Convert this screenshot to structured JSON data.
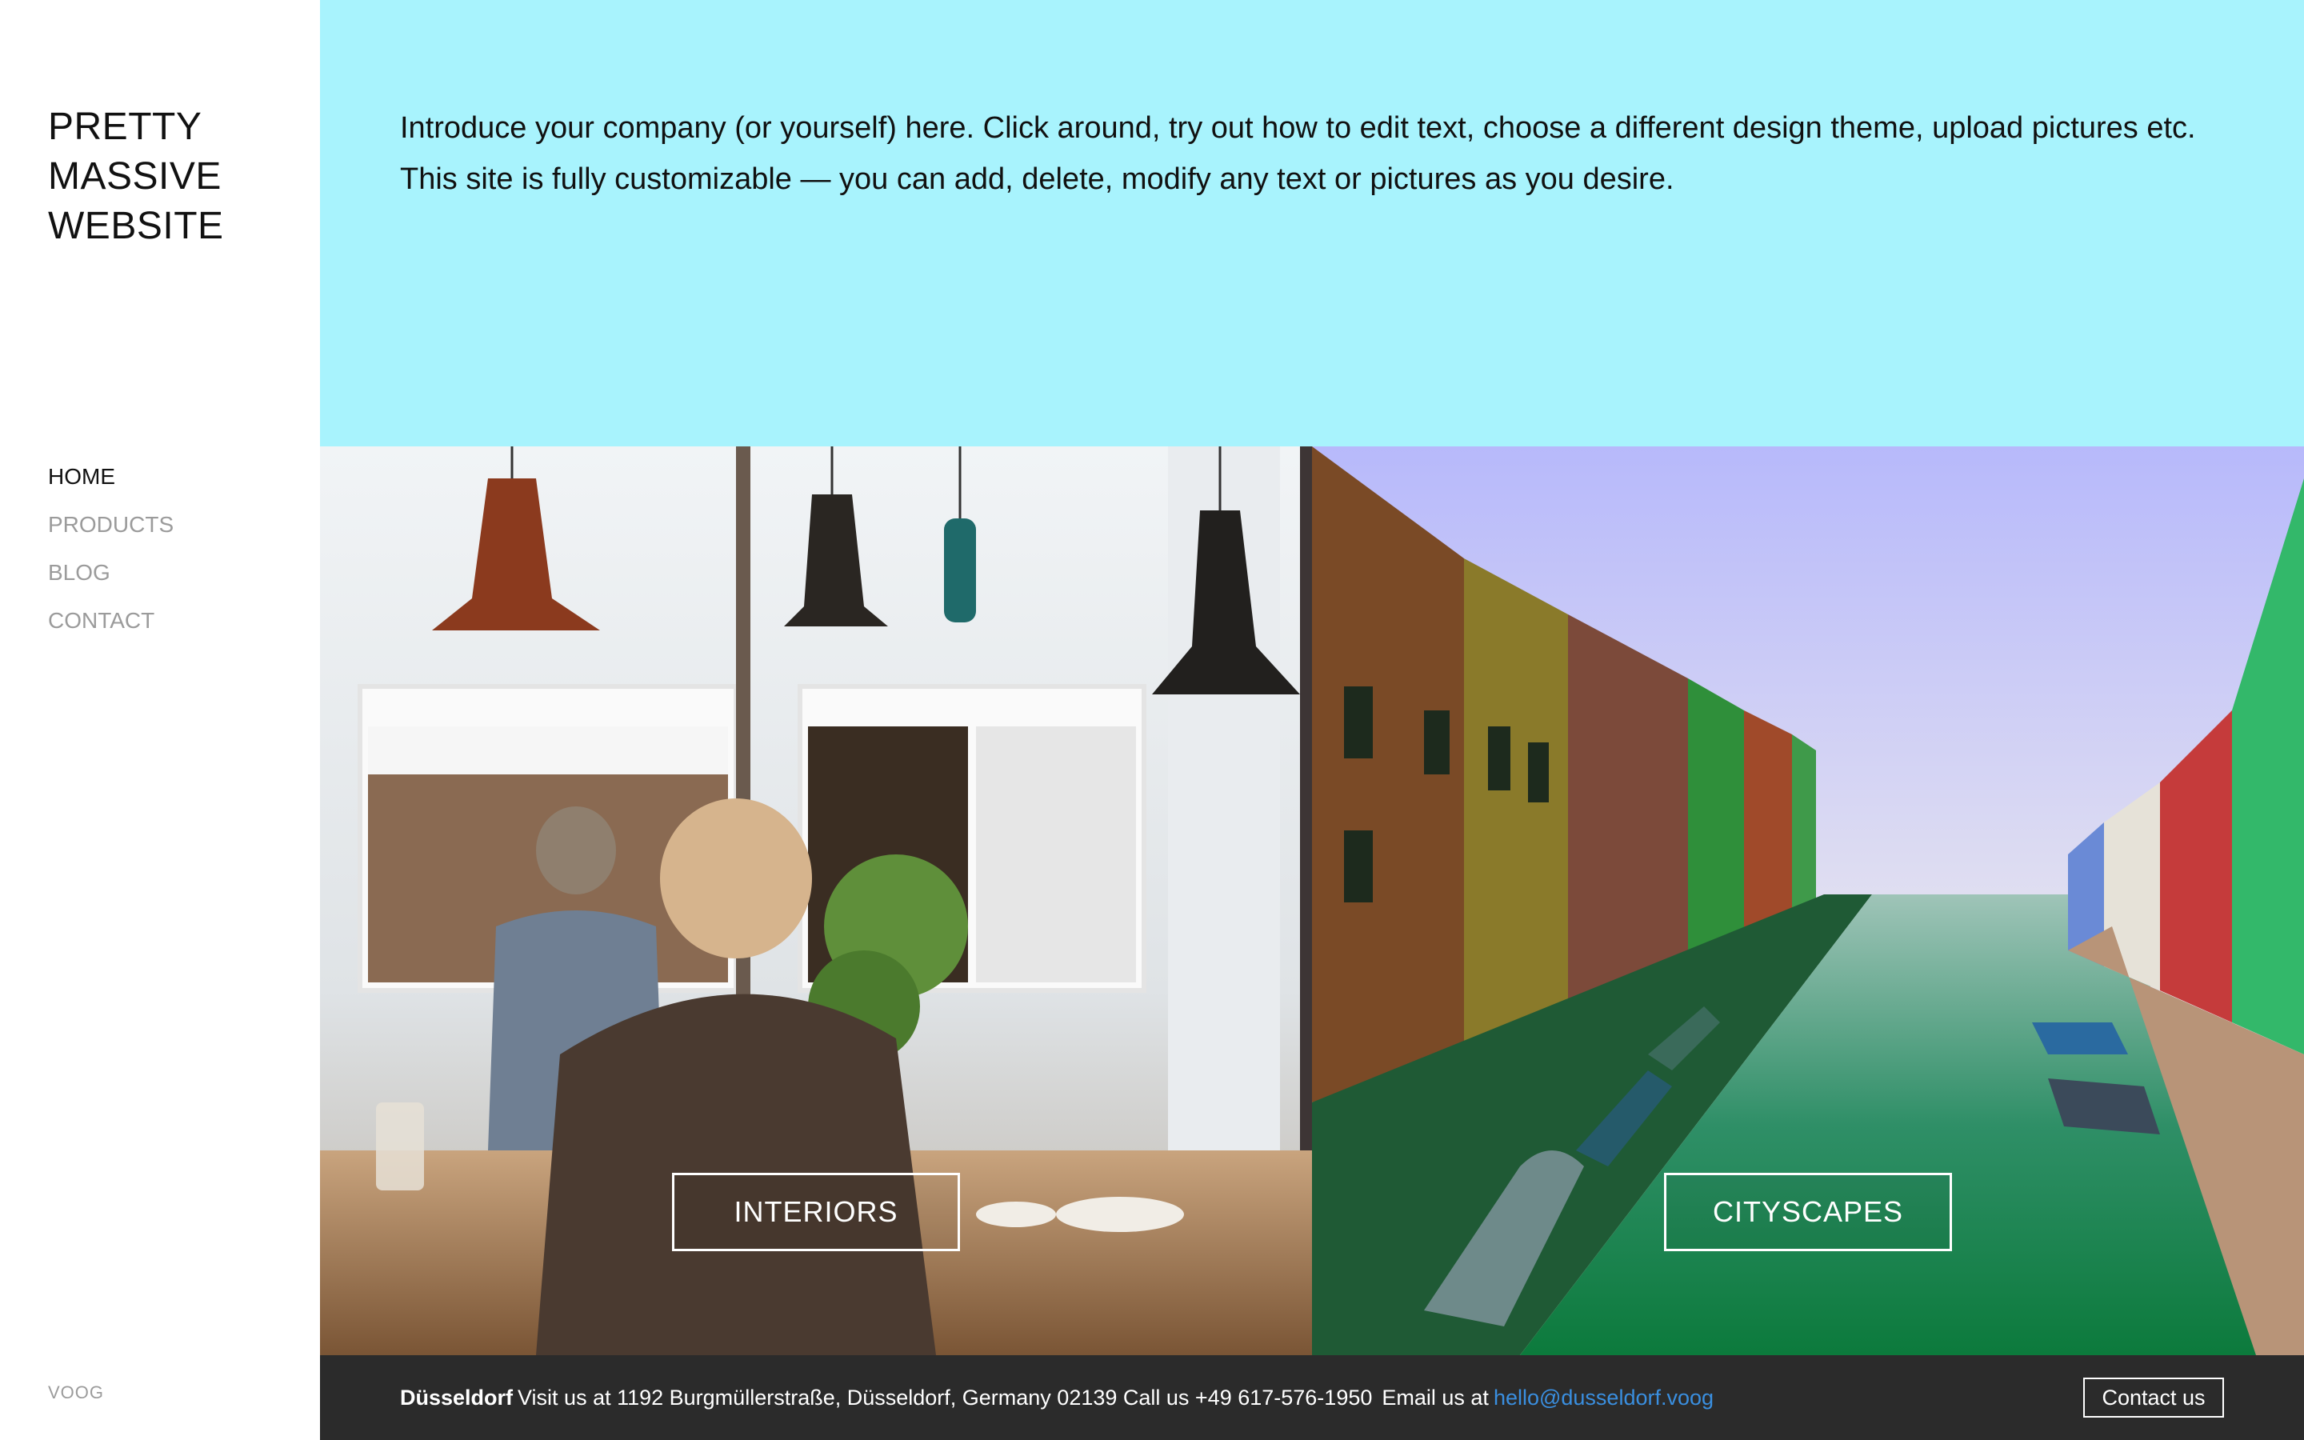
{
  "site": {
    "title_lines": [
      "PRETTY",
      "MASSIVE",
      "WEBSITE"
    ]
  },
  "nav": {
    "items": [
      {
        "label": "HOME",
        "active": true
      },
      {
        "label": "PRODUCTS",
        "active": false
      },
      {
        "label": "BLOG",
        "active": false
      },
      {
        "label": "CONTACT",
        "active": false
      }
    ]
  },
  "intro": {
    "text": "Introduce your company (or yourself) here. Click around, try out how to edit text, choose a different design theme, upload pictures etc. This site is fully customizable — you can add, delete, modify any text or pictures as you desire."
  },
  "tiles": {
    "interiors_label": "INTERIORS",
    "cityscapes_label": "CITYSCAPES"
  },
  "footer": {
    "city": "Düsseldorf",
    "address": "Visit us at 1192 Burgmüllerstraße, Düsseldorf, Germany 02139 Call us +49 617-576-1950",
    "email_prefix": "Email us at",
    "email": "hello@dusseldorf.voog",
    "contact_button": "Contact us"
  },
  "branding": {
    "platform_logo": "voog"
  },
  "colors": {
    "intro_background": "#a8f3fd",
    "footer_background": "#2b2b2b",
    "link": "#3a8fe0",
    "nav_inactive": "#9b9b9b"
  }
}
